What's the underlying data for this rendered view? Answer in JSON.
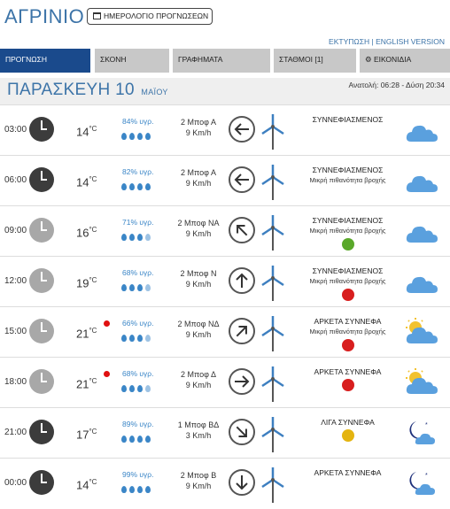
{
  "header": {
    "city": "ΑΓΡΙΝΙΟ",
    "calendar_button": "ΗΜΕΡΟΛΟΓΙΟ ΠΡΟΓΝΩΣΕΩΝ",
    "links": "ΕΚΤΥΠΩΣΗ | ENGLISH VERSION"
  },
  "tabs": [
    {
      "label": "ΠΡΟΓΝΩΣΗ",
      "active": true
    },
    {
      "label": "ΣΚΟΝΗ"
    },
    {
      "label": "ΓΡΑΦΗΜΑΤΑ"
    },
    {
      "label": "ΣΤΑΘΜΟΙ [1]"
    },
    {
      "label": "ΕΙΚΟΝΙΔΙΑ",
      "icon": "gear-icon"
    }
  ],
  "day": {
    "name": "ΠΑΡΑΣΚΕΥΗ 10",
    "month": "ΜΑΪΟΥ",
    "sun": "Ανατολή: 06:28 - Δύση 20:34"
  },
  "rows": [
    {
      "time": "03:00",
      "clock": "dark",
      "temp": "14",
      "unit": "°C",
      "humidity": "84% υγρ.",
      "drops": 4,
      "wind_bf": "2 Μποφ Α",
      "wind_kmh": "9 Km/h",
      "dir": "left",
      "cond": "ΣΥΝΝΕΦΙΑΣΜΕΝΟΣ",
      "sub": "",
      "badge": "",
      "icon": "cloud-icon"
    },
    {
      "time": "06:00",
      "clock": "dark",
      "temp": "14",
      "unit": "°C",
      "humidity": "82% υγρ.",
      "drops": 4,
      "wind_bf": "2 Μποφ Α",
      "wind_kmh": "9 Km/h",
      "dir": "left",
      "cond": "ΣΥΝΝΕΦΙΑΣΜΕΝΟΣ",
      "sub": "Μικρή πιθανότητα βροχής",
      "badge": "",
      "icon": "cloud-icon"
    },
    {
      "time": "09:00",
      "clock": "light",
      "temp": "16",
      "unit": "°C",
      "humidity": "71% υγρ.",
      "drops": 3,
      "wind_bf": "2 Μποφ ΝΑ",
      "wind_kmh": "9 Km/h",
      "dir": "upleft",
      "cond": "ΣΥΝΝΕΦΙΑΣΜΕΝΟΣ",
      "sub": "Μικρή πιθανότητα βροχής",
      "badge": "green",
      "icon": "cloud-icon"
    },
    {
      "time": "12:00",
      "clock": "light",
      "temp": "19",
      "unit": "°C",
      "humidity": "68% υγρ.",
      "drops": 3,
      "wind_bf": "2 Μποφ Ν",
      "wind_kmh": "9 Km/h",
      "dir": "up",
      "cond": "ΣΥΝΝΕΦΙΑΣΜΕΝΟΣ",
      "sub": "Μικρή πιθανότητα βροχής",
      "badge": "red",
      "icon": "cloud-icon"
    },
    {
      "time": "15:00",
      "clock": "light",
      "temp": "21",
      "unit": "°C",
      "humidity": "66% υγρ.",
      "drops": 3,
      "wind_bf": "2 Μποφ ΝΔ",
      "wind_kmh": "9 Km/h",
      "dir": "upright",
      "cond": "ΑΡΚΕΤΑ ΣΥΝΝΕΦΑ",
      "sub": "Μικρή πιθανότητα βροχής",
      "badge": "red",
      "icon": "sun-cloud-icon",
      "hot": true
    },
    {
      "time": "18:00",
      "clock": "light",
      "temp": "21",
      "unit": "°C",
      "humidity": "68% υγρ.",
      "drops": 3,
      "wind_bf": "2 Μποφ Δ",
      "wind_kmh": "9 Km/h",
      "dir": "right",
      "cond": "ΑΡΚΕΤΑ ΣΥΝΝΕΦΑ",
      "sub": "",
      "badge": "red",
      "icon": "sun-cloud-icon",
      "hot": true
    },
    {
      "time": "21:00",
      "clock": "dark",
      "temp": "17",
      "unit": "°C",
      "humidity": "89% υγρ.",
      "drops": 4,
      "wind_bf": "1 Μποφ ΒΔ",
      "wind_kmh": "3 Km/h",
      "dir": "downright",
      "cond": "ΛΙΓΑ ΣΥΝΝΕΦΑ",
      "sub": "",
      "badge": "yellow",
      "icon": "moon-cloud-icon"
    },
    {
      "time": "00:00",
      "clock": "dark",
      "temp": "14",
      "unit": "°C",
      "humidity": "99% υγρ.",
      "drops": 4,
      "wind_bf": "2 Μποφ Β",
      "wind_kmh": "9 Km/h",
      "dir": "down",
      "cond": "ΑΡΚΕΤΑ ΣΥΝΝΕΦΑ",
      "sub": "",
      "badge": "",
      "icon": "moon-cloud-icon"
    }
  ]
}
